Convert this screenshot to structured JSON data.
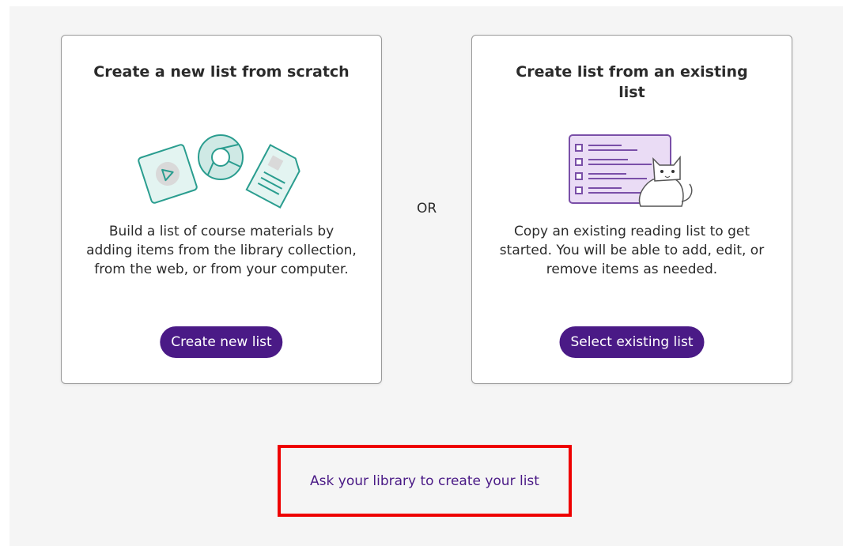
{
  "cards": {
    "new": {
      "title": "Create a new list from scratch",
      "description": "Build a list of course materials by adding items from the library collection, from the web, or from your computer.",
      "button_label": "Create new list",
      "illustration_icon": "media-web-document-icon"
    },
    "existing": {
      "title": "Create list from an existing list",
      "description": "Copy an existing reading list to get started. You will be able to add, edit, or remove items as needed.",
      "button_label": "Select existing list",
      "illustration_icon": "list-with-cat-icon"
    }
  },
  "separator": {
    "label": "OR"
  },
  "ask_library": {
    "link_label": "Ask your library to create your list"
  },
  "colors": {
    "accent": "#4a1a86",
    "illustration_teal": "#2a9d8f",
    "illustration_lilac": "#eadcf5",
    "highlight_border": "#ee0000",
    "background": "#f5f5f5"
  }
}
